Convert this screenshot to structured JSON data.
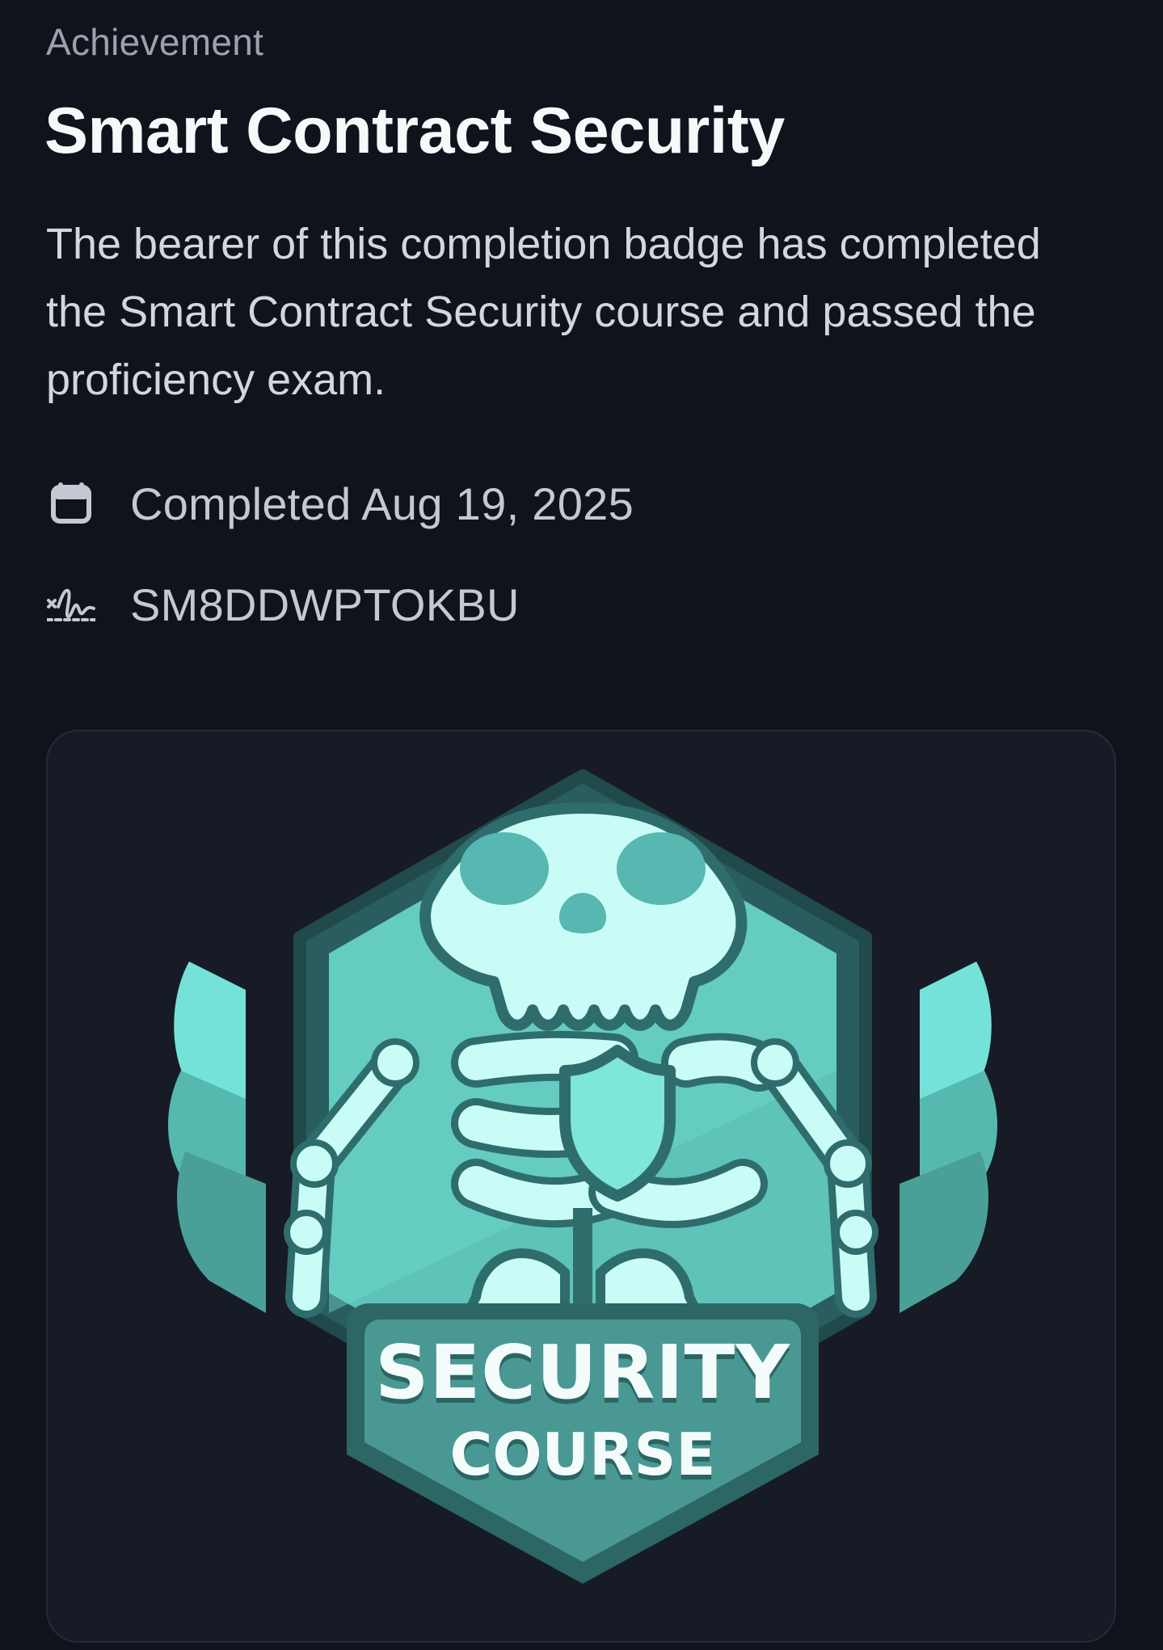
{
  "header": {
    "eyebrow": "Achievement",
    "title": "Smart Contract Security",
    "description": "The bearer of this completion badge has completed the Smart Contract Security course and passed the proficiency exam."
  },
  "meta": {
    "completed": {
      "icon": "calendar-icon",
      "text": "Completed Aug 19, 2025"
    },
    "credential": {
      "icon": "signature-icon",
      "text": "SM8DDWPTOKBU"
    }
  },
  "badge": {
    "line1": "SECURITY",
    "line2": "COURSE",
    "colors": {
      "wing_light": "#74e2d8",
      "wing_mid": "#55b9b0",
      "wing_dark": "#4a9f99",
      "hex_outer": "#2a5d5f",
      "hex_inner": "#5ec3b9",
      "bone": "#c9fbf7",
      "plate": "#4a9893",
      "plate_border": "#2c6665"
    }
  },
  "theme": {
    "background": "#10131c",
    "card_background": "#171b25",
    "card_border": "#262b37"
  }
}
